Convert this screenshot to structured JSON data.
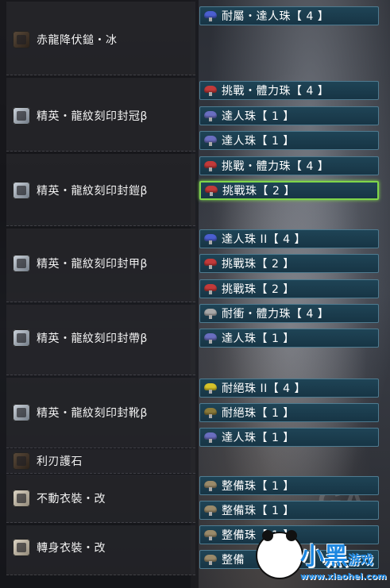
{
  "equipment": [
    {
      "name": "赤龍降伏鎚・冰",
      "icon": "great-hammer-icon"
    },
    {
      "name": "精英・龍紋刻印封冠β",
      "icon": "helmet-icon"
    },
    {
      "name": "精英・龍紋刻印封鎧β",
      "icon": "chest-armor-icon"
    },
    {
      "name": "精英・龍紋刻印封甲β",
      "icon": "arm-armor-icon"
    },
    {
      "name": "精英・龍紋刻印封帶β",
      "icon": "waist-armor-icon"
    },
    {
      "name": "精英・龍紋刻印封靴β",
      "icon": "leg-armor-icon"
    },
    {
      "name": "利刃護石",
      "icon": "charm-icon"
    },
    {
      "name": "不動衣裝・改",
      "icon": "mantle-icon"
    },
    {
      "name": "轉身衣裝・改",
      "icon": "mantle-icon"
    }
  ],
  "slots": [
    {
      "label": "耐屬・達人珠【 4 】",
      "gem_color": "#4b5fd0"
    },
    {
      "label": "挑戰・體力珠【 4 】",
      "gem_color": "#c23a3a"
    },
    {
      "label": "達人珠【 1 】",
      "gem_color": "#6a6ec0"
    },
    {
      "label": "達人珠【 1 】",
      "gem_color": "#6a6ec0"
    },
    {
      "label": "挑戰・體力珠【 4 】",
      "gem_color": "#c23a3a"
    },
    {
      "label": "挑戰珠【 2 】",
      "gem_color": "#c23a3a",
      "selected": true
    },
    {
      "label": "達人珠 II【 4 】",
      "gem_color": "#4b5fd0"
    },
    {
      "label": "挑戰珠【 2 】",
      "gem_color": "#c23a3a"
    },
    {
      "label": "挑戰珠【 2 】",
      "gem_color": "#c23a3a"
    },
    {
      "label": "耐衝・體力珠【 4 】",
      "gem_color": "#a8a8a8"
    },
    {
      "label": "達人珠【 1 】",
      "gem_color": "#6a6ec0"
    },
    {
      "label": "耐絕珠 II【 4 】",
      "gem_color": "#d6c22a"
    },
    {
      "label": "耐絕珠【 1 】",
      "gem_color": "#8a7a3a"
    },
    {
      "label": "達人珠【 1 】",
      "gem_color": "#6a6ec0"
    },
    {
      "label": "整備珠【 1 】",
      "gem_color": "#9a8a6a"
    },
    {
      "label": "整備珠【 1 】",
      "gem_color": "#9a8a6a"
    },
    {
      "label": "整備珠【 1 】",
      "gem_color": "#9a8a6a"
    },
    {
      "label": "整備",
      "gem_color": "#9a8a6a"
    }
  ],
  "watermark": {
    "text": "GA"
  },
  "logo": {
    "main": "小黑",
    "sub": "游戏",
    "url": "www.xiaohei.com"
  }
}
